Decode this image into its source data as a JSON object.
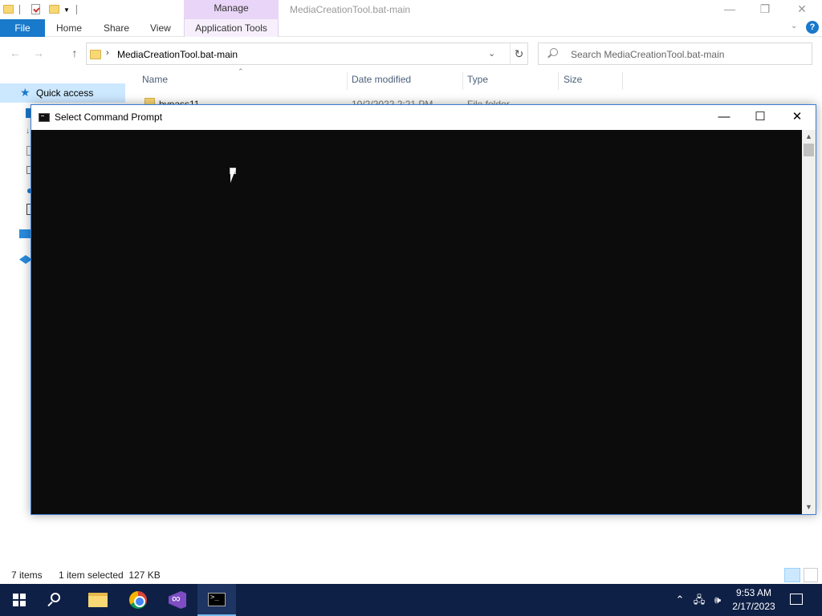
{
  "explorer": {
    "title": "MediaCreationTool.bat-main",
    "manage_tab": "Manage",
    "ribbon_tabs": {
      "file": "File",
      "home": "Home",
      "share": "Share",
      "view": "View",
      "application_tools": "Application Tools"
    },
    "address": {
      "path": "MediaCreationTool.bat-main"
    },
    "search": {
      "placeholder": "Search MediaCreationTool.bat-main"
    },
    "nav_pane": {
      "quick_access": "Quick access"
    },
    "columns": {
      "name": "Name",
      "date_modified": "Date modified",
      "type": "Type",
      "size": "Size"
    },
    "rows": [
      {
        "name": "bypass11",
        "date": "10/2/2022 2:21 PM",
        "type": "File folder"
      }
    ],
    "status": {
      "items": "7 items",
      "selected": "1 item selected  127 KB"
    }
  },
  "cmd_window": {
    "title": "Select Command Prompt"
  },
  "taskbar": {
    "clock_time": "9:53 AM",
    "clock_date": "2/17/2023",
    "apps": [
      "start-icon",
      "search-icon",
      "file-explorer-icon",
      "chrome-icon",
      "visual-studio-icon",
      "command-prompt-icon"
    ]
  },
  "colors": {
    "accent": "#1979ca",
    "manage_tab": "#e9d5f7",
    "taskbar": "#0f2046",
    "console_bg": "#0c0c0c"
  }
}
